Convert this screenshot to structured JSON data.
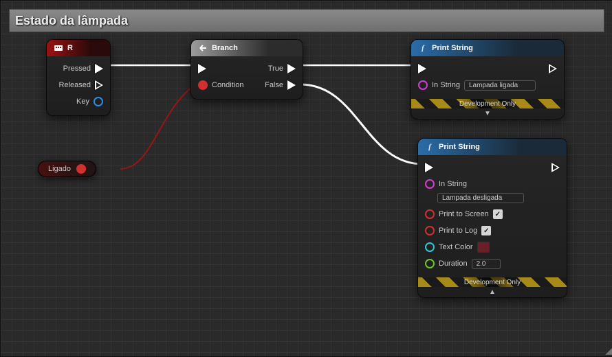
{
  "titleBar": {
    "title": "Estado da lâmpada"
  },
  "nodes": {
    "keyR": {
      "title": "R",
      "pins": {
        "pressed": "Pressed",
        "released": "Released",
        "key": "Key"
      }
    },
    "branch": {
      "title": "Branch",
      "pins": {
        "condition": "Condition",
        "true": "True",
        "false": "False"
      }
    },
    "printTrue": {
      "title": "Print String",
      "pins": {
        "inString": "In String",
        "inStringValue": "Lampada ligada"
      },
      "footer": "Development Only"
    },
    "printFalse": {
      "title": "Print String",
      "pins": {
        "inString": "In String",
        "inStringValue": "Lampada desligada",
        "printToScreen": "Print to Screen",
        "printToLog": "Print to Log",
        "textColor": "Text Color",
        "duration": "Duration",
        "durationValue": "2.0"
      },
      "footer": "Development Only"
    },
    "variable": {
      "label": "Ligado"
    }
  }
}
